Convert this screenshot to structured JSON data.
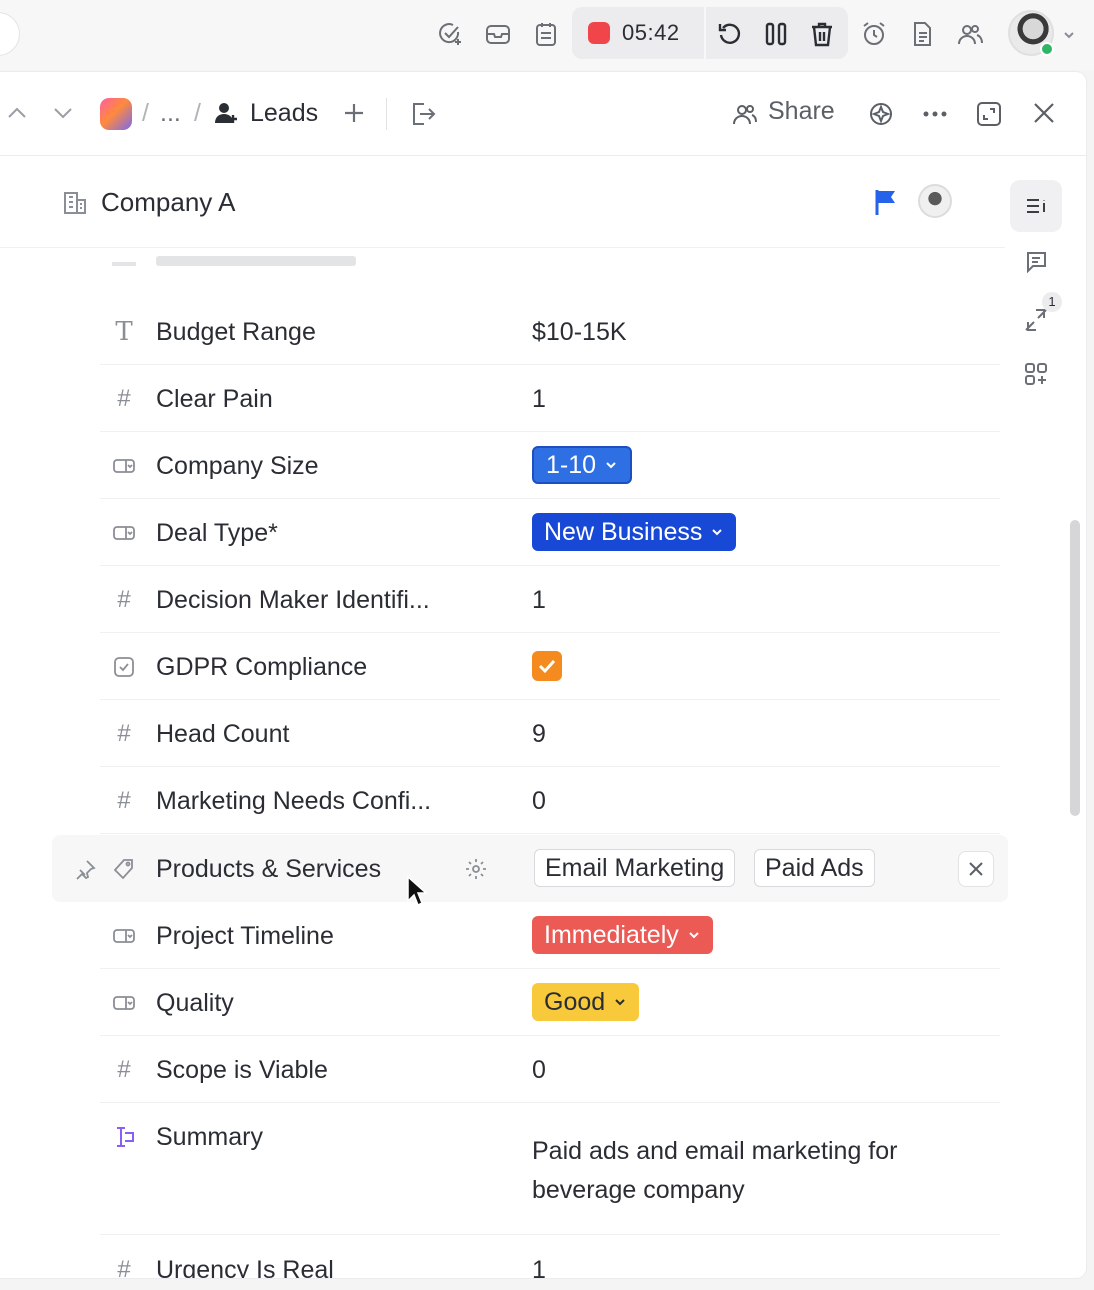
{
  "topbar": {
    "timer": "05:42",
    "icons": [
      "check-add-icon",
      "inbox-icon",
      "notepad-icon",
      "record-icon",
      "undo-icon",
      "pause-icon",
      "trash-icon",
      "alarm-icon",
      "doc-icon",
      "people-icon",
      "avatar",
      "chevron-down-icon"
    ]
  },
  "header": {
    "breadcrumb_ellipsis": "...",
    "breadcrumb_sep": "/",
    "list_name": "Leads",
    "share_label": "Share"
  },
  "task": {
    "title": "Company A",
    "priority_flag_color": "#2563eb"
  },
  "fields": [
    {
      "icon": "text-icon",
      "label": "Budget Range",
      "value": "$10-15K",
      "type": "text"
    },
    {
      "icon": "hash-icon",
      "label": "Clear Pain",
      "value": "1",
      "type": "number"
    },
    {
      "icon": "dropdown-icon",
      "label": "Company Size",
      "value": "1-10",
      "type": "dropdown",
      "color": "#2f6fe4"
    },
    {
      "icon": "dropdown-icon",
      "label": "Deal Type*",
      "value": "New Business",
      "type": "dropdown",
      "color": "#1849d6"
    },
    {
      "icon": "hash-icon",
      "label": "Decision Maker Identifi...",
      "value": "1",
      "type": "number"
    },
    {
      "icon": "checkbox-icon",
      "label": "GDPR Compliance",
      "value": "checked",
      "type": "checkbox",
      "color": "#f58a1f"
    },
    {
      "icon": "hash-icon",
      "label": "Head Count",
      "value": "9",
      "type": "number"
    },
    {
      "icon": "hash-icon",
      "label": "Marketing Needs Confi...",
      "value": "0",
      "type": "number"
    },
    {
      "icon": "tag-icon",
      "label": "Products & Services",
      "type": "labels",
      "values": [
        "Email Marketing",
        "Paid Ads"
      ]
    },
    {
      "icon": "dropdown-icon",
      "label": "Project Timeline",
      "value": "Immediately",
      "type": "dropdown",
      "color": "#ec5a55"
    },
    {
      "icon": "dropdown-icon",
      "label": "Quality",
      "value": "Good",
      "type": "dropdown",
      "color": "#f8c93a"
    },
    {
      "icon": "hash-icon",
      "label": "Scope is Viable",
      "value": "0",
      "type": "number"
    },
    {
      "icon": "ai-summary-icon",
      "label": "Summary",
      "value_line1": "Paid ads and email marketing for",
      "value_line2": "beverage company",
      "type": "text"
    },
    {
      "icon": "hash-icon",
      "label": "Urgency Is Real",
      "value": "1",
      "type": "number"
    }
  ],
  "rail": {
    "activity_badge": "1"
  }
}
